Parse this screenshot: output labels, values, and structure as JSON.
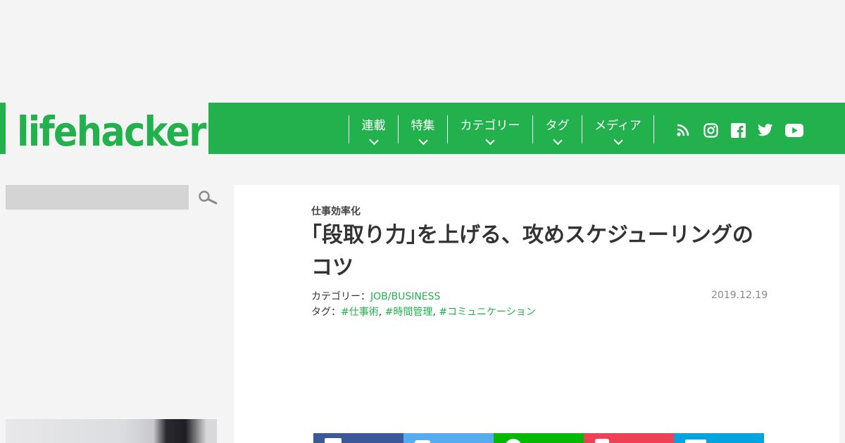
{
  "logo": {
    "text": "lifehacker"
  },
  "nav": {
    "items": [
      {
        "label": "連載"
      },
      {
        "label": "特集"
      },
      {
        "label": "カテゴリー"
      },
      {
        "label": "タグ"
      },
      {
        "label": "メディア"
      }
    ]
  },
  "social": {
    "icons": [
      "rss-icon",
      "instagram-icon",
      "facebook-icon",
      "twitter-icon",
      "youtube-icon"
    ]
  },
  "search": {
    "placeholder": ""
  },
  "article": {
    "category_crumb": "仕事効率化",
    "title": "｢段取り力｣を上げる、攻めスケジューリングのコツ",
    "category_label": "カテゴリー：",
    "category_value": "JOB/BUSINESS",
    "tags_label": "タグ：",
    "tags": [
      "#仕事術",
      "#時間管理",
      "#コミュニケーション"
    ],
    "tag_separator": ", ",
    "date": "2019.12.19"
  },
  "colors": {
    "brand_green": "#22b14c",
    "facebook": "#3b5998",
    "twitter": "#55acee",
    "line": "#00b900",
    "pocket": "#ef4056",
    "hatena": "#00a4de"
  }
}
